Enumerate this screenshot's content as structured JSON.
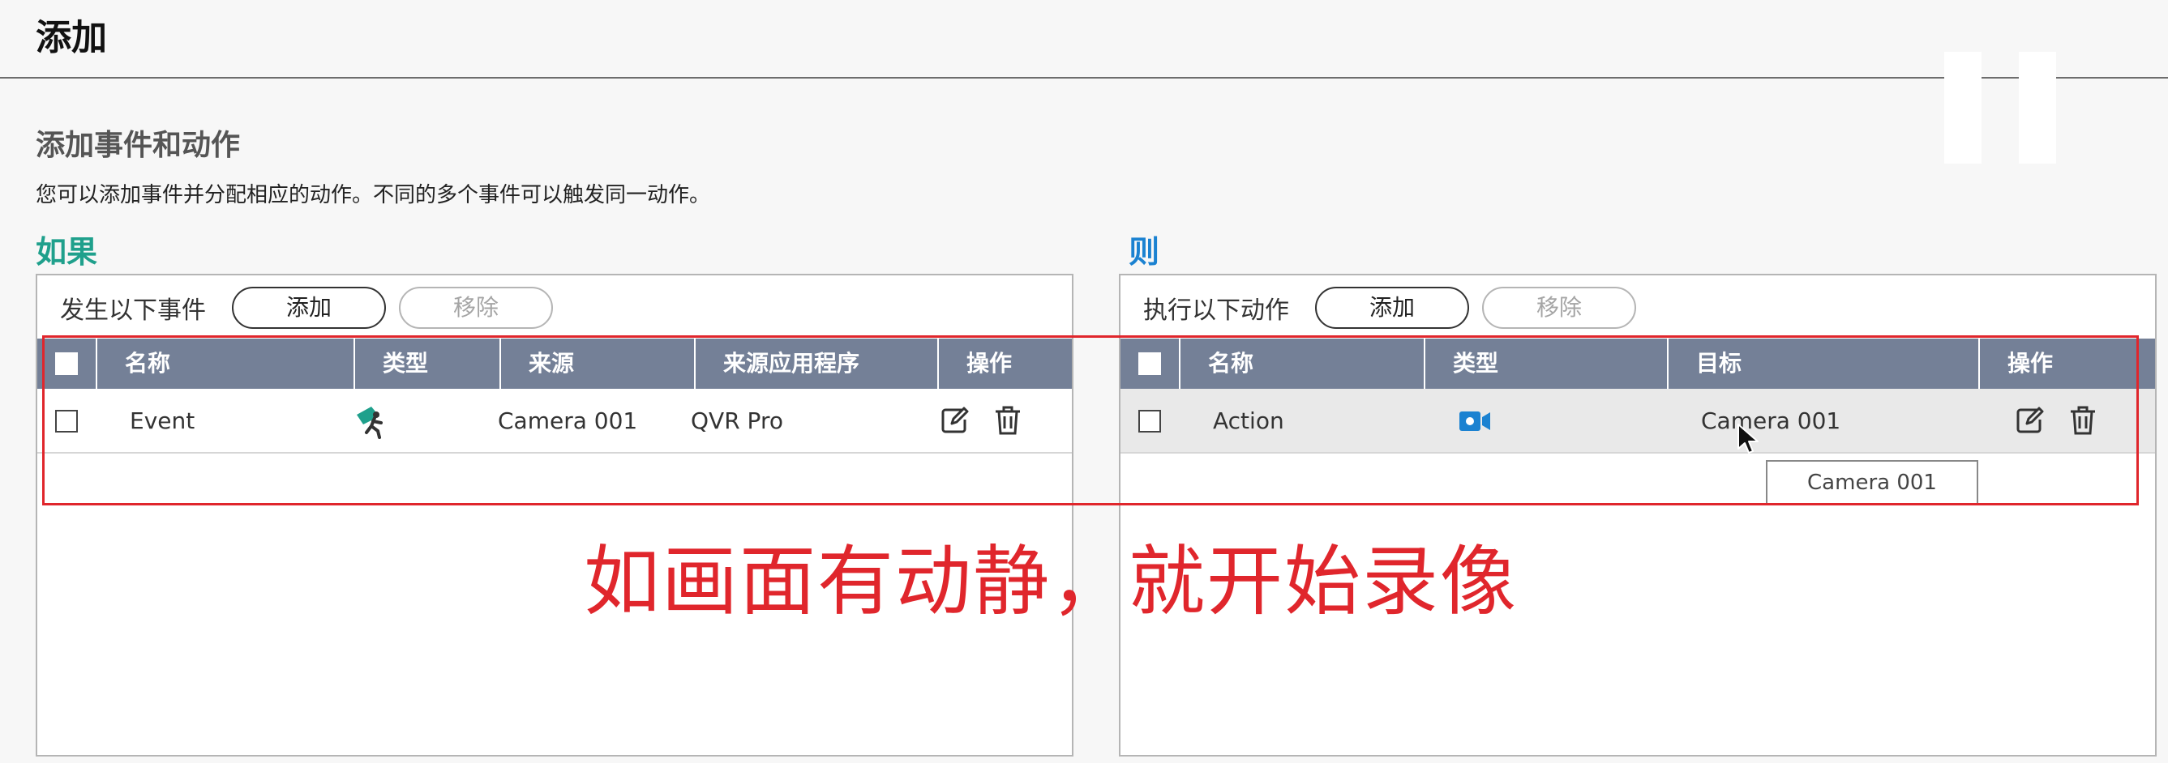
{
  "header": {
    "title": "添加"
  },
  "section": {
    "title": "添加事件和动作",
    "description": "您可以添加事件并分配相应的动作。不同的多个事件可以触发同一动作。"
  },
  "if_panel": {
    "label": "如果",
    "toolbar_label": "发生以下事件",
    "add_label": "添加",
    "remove_label": "移除",
    "columns": [
      "名称",
      "类型",
      "来源",
      "来源应用程序",
      "操作"
    ],
    "rows": [
      {
        "name": "Event",
        "type_icon": "motion-detection-icon",
        "source": "Camera 001",
        "source_app": "QVR Pro"
      }
    ]
  },
  "then_panel": {
    "label": "则",
    "toolbar_label": "执行以下动作",
    "add_label": "添加",
    "remove_label": "移除",
    "columns": [
      "名称",
      "类型",
      "目标",
      "操作"
    ],
    "rows": [
      {
        "name": "Action",
        "type_icon": "video-recording-icon",
        "target": "Camera 001"
      }
    ]
  },
  "tooltip": {
    "text": "Camera 001"
  },
  "annotation": {
    "text": "如画面有动静，就开始录像"
  },
  "colors": {
    "if_accent": "#1fa08c",
    "then_accent": "#1b82d1",
    "table_header": "#748097",
    "annotation_red": "#e0262c"
  }
}
